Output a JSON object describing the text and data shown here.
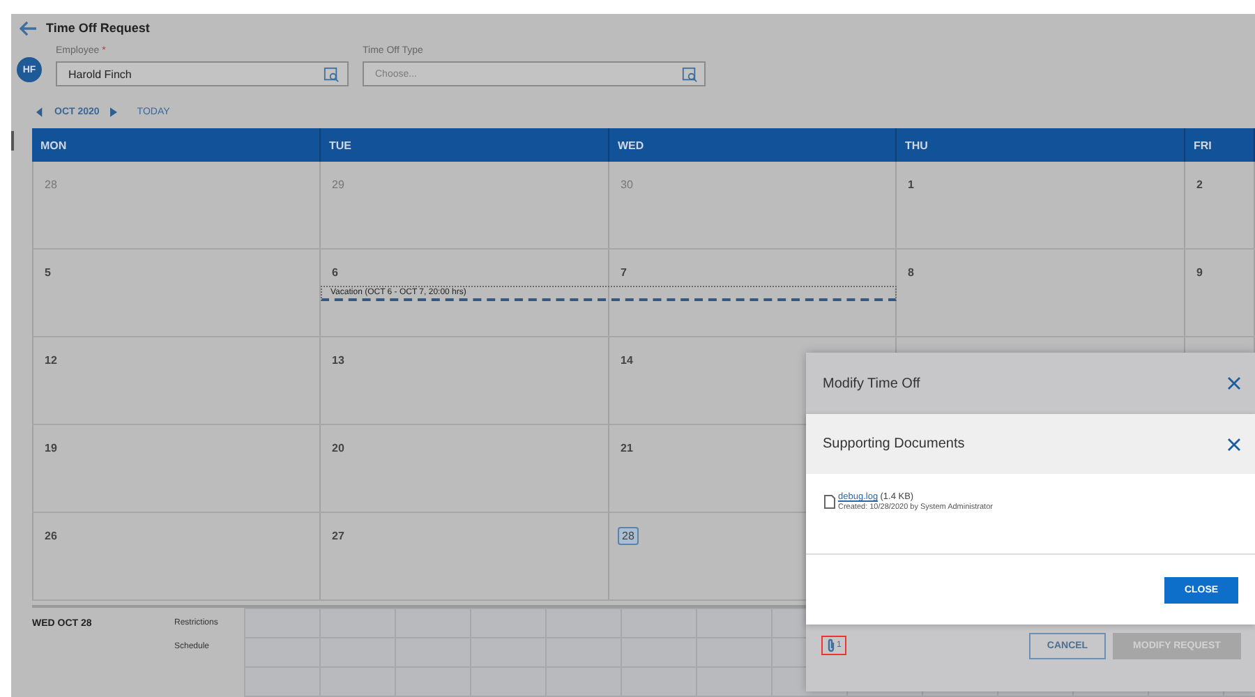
{
  "page": {
    "title": "Time Off Request"
  },
  "form": {
    "avatar": "HF",
    "employee": {
      "label": "Employee",
      "required_mark": "*",
      "value": "Harold Finch"
    },
    "time_off_type": {
      "label": "Time Off Type",
      "placeholder": "Choose..."
    }
  },
  "calendar_nav": {
    "month": "OCT 2020",
    "today": "TODAY"
  },
  "calendar": {
    "days": [
      "MON",
      "TUE",
      "WED",
      "THU",
      "FRI"
    ],
    "weeks": [
      [
        {
          "date": "28",
          "muted": true,
          "selected": false
        },
        {
          "date": "29",
          "muted": true,
          "selected": false
        },
        {
          "date": "30",
          "muted": true,
          "selected": false
        },
        {
          "date": "1",
          "muted": false,
          "selected": false
        },
        {
          "date": "2",
          "muted": false,
          "selected": false
        }
      ],
      [
        {
          "date": "5",
          "muted": false,
          "selected": false
        },
        {
          "date": "6",
          "muted": false,
          "selected": false,
          "event": {
            "label": "Vacation (OCT 6 - OCT 7, 20:00 hrs)"
          }
        },
        {
          "date": "7",
          "muted": false,
          "selected": false
        },
        {
          "date": "8",
          "muted": false,
          "selected": false
        },
        {
          "date": "9",
          "muted": false,
          "selected": false
        }
      ],
      [
        {
          "date": "12",
          "muted": false,
          "selected": false
        },
        {
          "date": "13",
          "muted": false,
          "selected": false
        },
        {
          "date": "14",
          "muted": false,
          "selected": false
        }
      ],
      [
        {
          "date": "19",
          "muted": false,
          "selected": false
        },
        {
          "date": "20",
          "muted": false,
          "selected": false
        },
        {
          "date": "21",
          "muted": false,
          "selected": false
        }
      ],
      [
        {
          "date": "26",
          "muted": false,
          "selected": false
        },
        {
          "date": "27",
          "muted": false,
          "selected": false
        },
        {
          "date": "28",
          "muted": false,
          "selected": true
        }
      ]
    ]
  },
  "day_panel": {
    "date": "WED OCT 28",
    "rows": [
      "Restrictions",
      "Schedule"
    ]
  },
  "modal": {
    "title": "Modify Time Off",
    "attachment_count": "1",
    "buttons": [
      {
        "label": "CANCEL",
        "disabled": false
      },
      {
        "label": "MODIFY REQUEST",
        "disabled": true
      }
    ]
  },
  "documents_dialog": {
    "title": "Supporting Documents",
    "files": [
      {
        "name": "debug.log",
        "size": "(1.4 KB)",
        "created": "Created: 10/28/2020 by System Administrator"
      }
    ],
    "button": "CLOSE"
  }
}
